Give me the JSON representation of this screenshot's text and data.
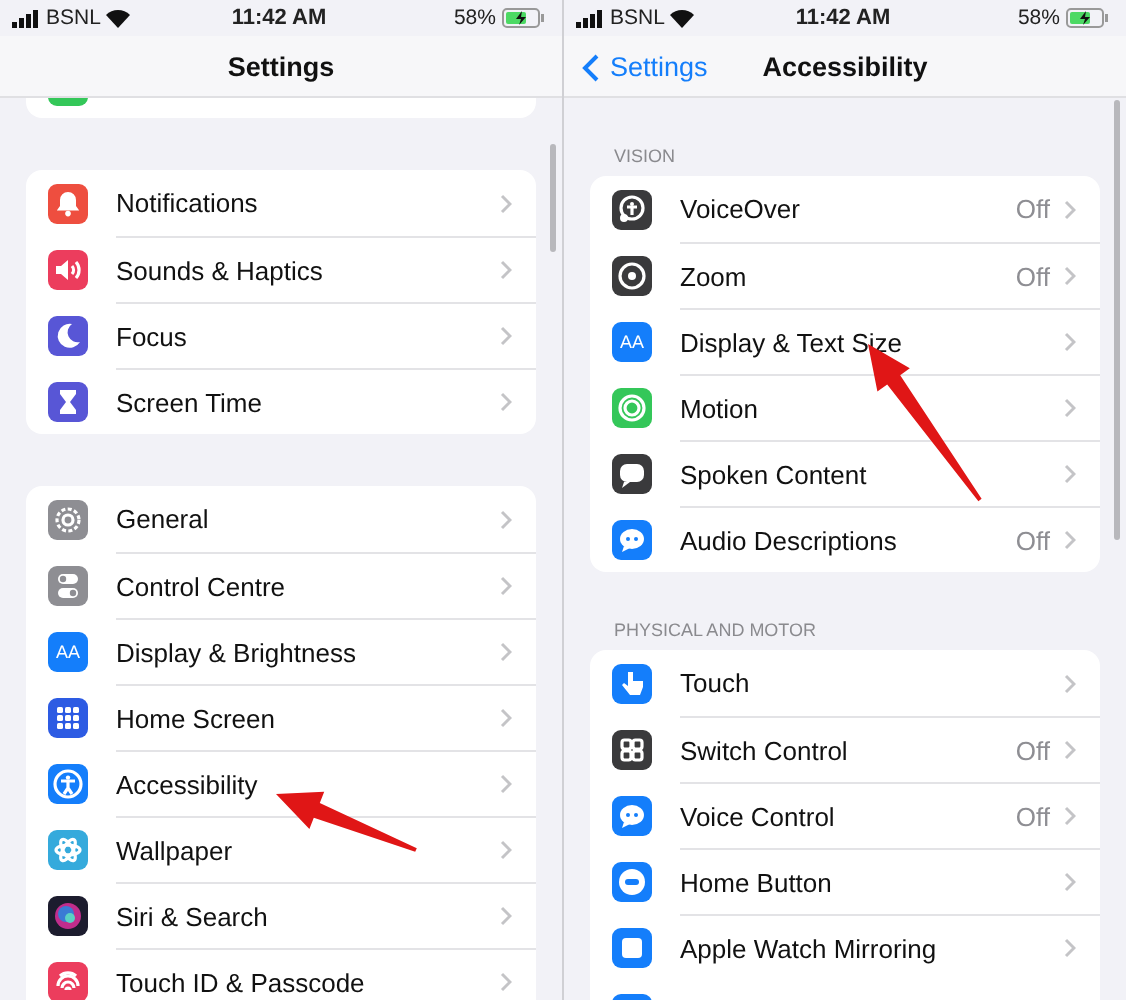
{
  "panels": [
    {
      "status_bar": {
        "carrier": "BSNL",
        "time": "11:42 AM",
        "battery": "58%"
      },
      "nav": {
        "title": "Settings"
      },
      "groups": [
        {
          "cut_top": true,
          "items": [
            {
              "color": "#34c759"
            }
          ]
        },
        {
          "items": [
            {
              "label": "Notifications",
              "color": "#ee4e3f"
            },
            {
              "label": "Sounds & Haptics",
              "color": "#ec3d5d"
            },
            {
              "label": "Focus",
              "color": "#5856d6"
            },
            {
              "label": "Screen Time",
              "color": "#5856d6"
            }
          ]
        },
        {
          "items": [
            {
              "label": "General",
              "color": "#8e8e93"
            },
            {
              "label": "Control Centre",
              "color": "#8e8e93"
            },
            {
              "label": "Display & Brightness",
              "color": "#147efb",
              "icon_text": "AA"
            },
            {
              "label": "Home Screen",
              "color": "#2d5be3"
            },
            {
              "label": "Accessibility",
              "color": "#147efb"
            },
            {
              "label": "Wallpaper",
              "color": "#35aadc"
            },
            {
              "label": "Siri & Search",
              "color": "#1c1c2e"
            },
            {
              "label": "Touch ID & Passcode",
              "color": "#ec3d5d"
            }
          ]
        }
      ]
    },
    {
      "status_bar": {
        "carrier": "BSNL",
        "time": "11:42 AM",
        "battery": "58%"
      },
      "nav": {
        "back": "Settings",
        "title": "Accessibility"
      },
      "groups": [
        {
          "header": "VISION",
          "items": [
            {
              "label": "VoiceOver",
              "value": "Off",
              "color": "#3a3a3c"
            },
            {
              "label": "Zoom",
              "value": "Off",
              "color": "#3a3a3c"
            },
            {
              "label": "Display & Text Size",
              "color": "#147efb",
              "icon_text": "AA"
            },
            {
              "label": "Motion",
              "color": "#34c759"
            },
            {
              "label": "Spoken Content",
              "color": "#3a3a3c"
            },
            {
              "label": "Audio Descriptions",
              "value": "Off",
              "color": "#147efb"
            }
          ]
        },
        {
          "header": "PHYSICAL AND MOTOR",
          "items": [
            {
              "label": "Touch",
              "color": "#147efb"
            },
            {
              "label": "Switch Control",
              "value": "Off",
              "color": "#3a3a3c"
            },
            {
              "label": "Voice Control",
              "value": "Off",
              "color": "#147efb"
            },
            {
              "label": "Home Button",
              "color": "#147efb"
            },
            {
              "label": "Apple Watch Mirroring",
              "color": "#147efb"
            },
            {
              "color": "#147efb"
            }
          ]
        }
      ]
    }
  ]
}
